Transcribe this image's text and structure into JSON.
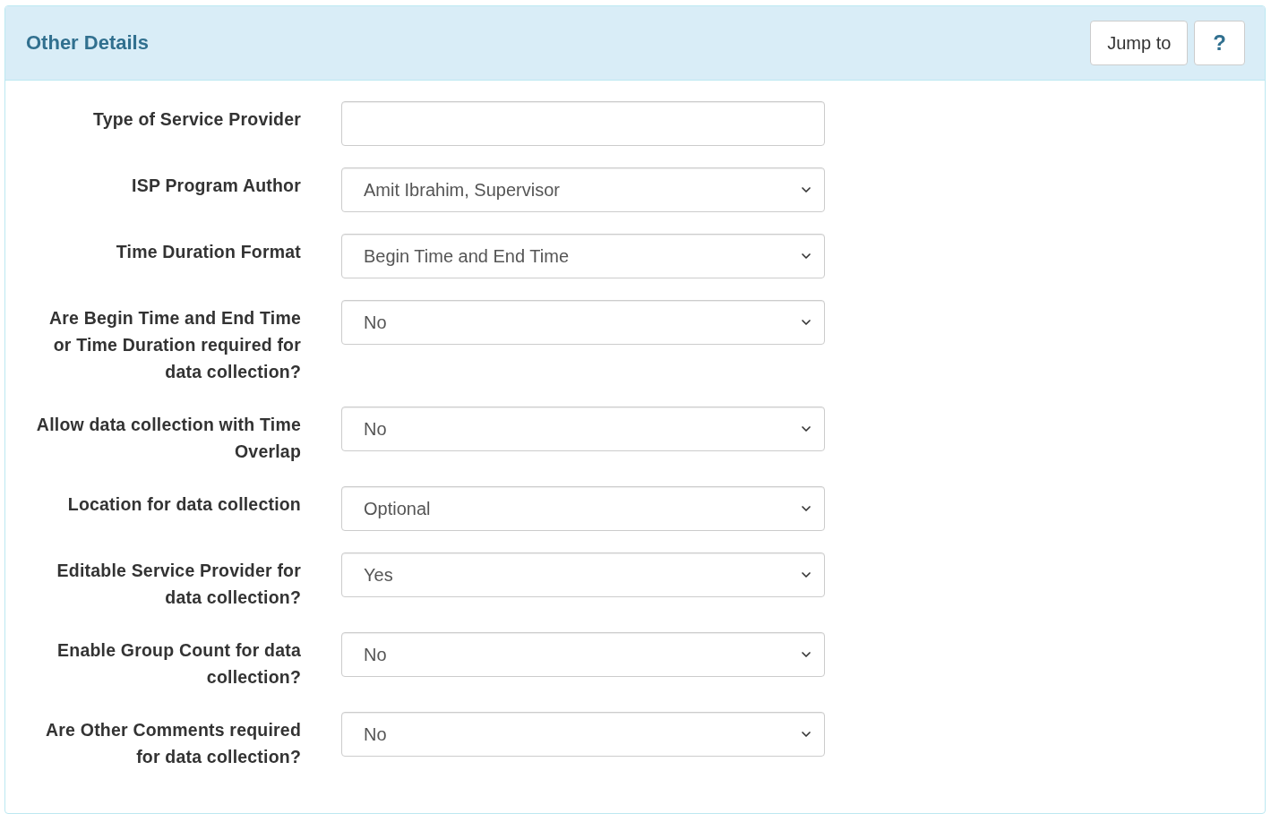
{
  "panel": {
    "title": "Other Details",
    "buttons": [
      {
        "kind": "text",
        "label": "Jump to"
      },
      {
        "kind": "help",
        "label": "?"
      }
    ]
  },
  "fields": [
    {
      "label": "Type of Service Provider",
      "kind": "text"
    },
    {
      "label": "ISP Program Author",
      "kind": "select",
      "value": "Amit Ibrahim, Supervisor"
    },
    {
      "label": "Time Duration Format",
      "kind": "select",
      "value": "Begin Time and End Time"
    },
    {
      "label": "Are Begin Time and End Time or Time Duration required for data collection?",
      "kind": "select",
      "value": "No"
    },
    {
      "label": "Allow data collection with Time Overlap",
      "kind": "select",
      "value": "No"
    },
    {
      "label": "Location for data collection",
      "kind": "select",
      "value": "Optional"
    },
    {
      "label": "Editable Service Provider for data collection?",
      "kind": "select",
      "value": "Yes"
    },
    {
      "label": "Enable Group Count for data collection?",
      "kind": "select",
      "value": "No"
    },
    {
      "label": "Are Other Comments required for data collection?",
      "kind": "select",
      "value": "No"
    }
  ]
}
